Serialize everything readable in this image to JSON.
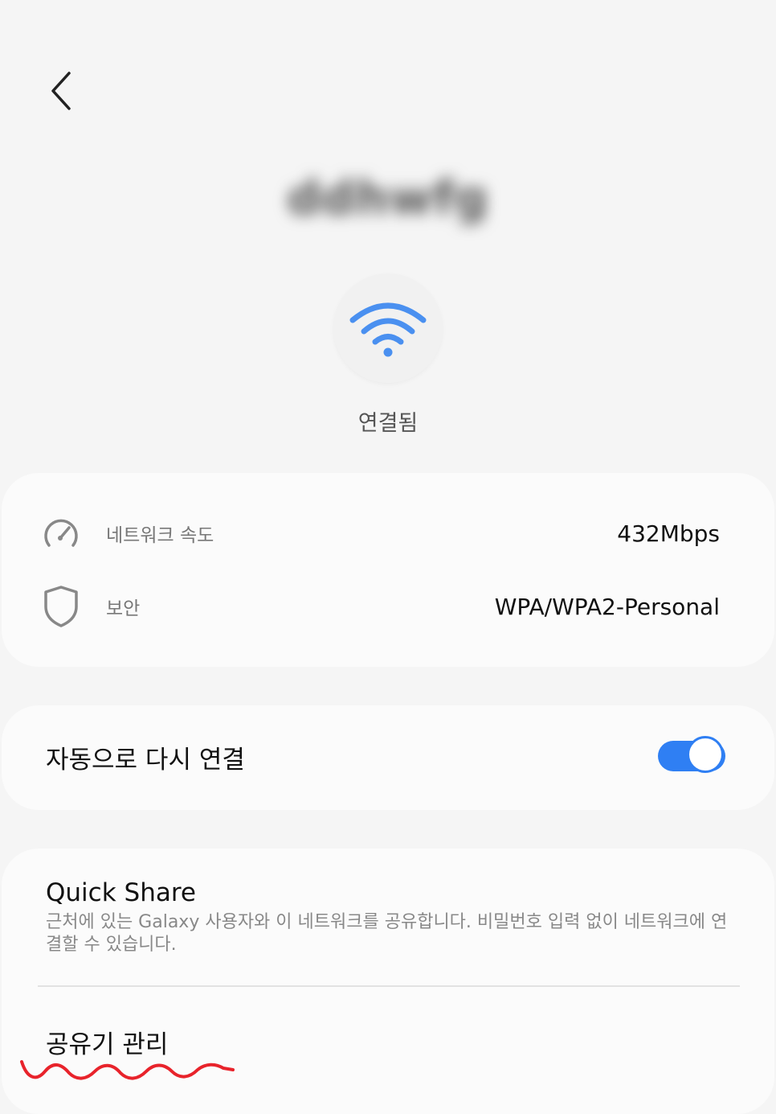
{
  "header": {
    "back_icon": "chevron-left-icon",
    "network_name": "ddhwfg"
  },
  "status": {
    "icon": "wifi-icon",
    "text": "연결됨"
  },
  "info": {
    "speed": {
      "icon": "speedometer-icon",
      "label": "네트워크 속도",
      "value": "432Mbps"
    },
    "security": {
      "icon": "shield-icon",
      "label": "보안",
      "value": "WPA/WPA2-Personal"
    }
  },
  "auto_reconnect": {
    "label": "자동으로 다시 연결",
    "enabled": true
  },
  "quick_share": {
    "title": "Quick Share",
    "description": "근처에 있는 Galaxy 사용자와 이 네트워크를 공유합니다. 비밀번호 입력 없이 네트워크에 연결할 수 있습니다."
  },
  "router": {
    "label": "공유기 관리"
  },
  "colors": {
    "accent": "#2f7ff3",
    "wifi": "#4a90f0",
    "annotation": "#e8232b"
  }
}
